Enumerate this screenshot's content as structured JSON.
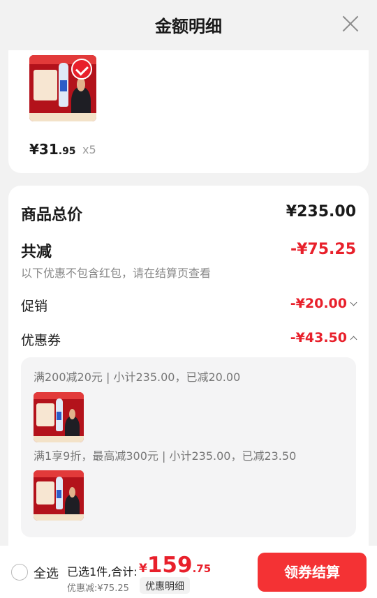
{
  "header": {
    "title": "金额明细",
    "close_icon": "close-icon"
  },
  "product": {
    "unit_price_main": "¥31",
    "unit_price_decimal": ".95",
    "quantity": "x5",
    "check_icon": "check-icon"
  },
  "summary": {
    "total_label": "商品总价",
    "total_value": "¥235.00",
    "reduce_label": "共减",
    "reduce_value": "-¥75.25",
    "reduce_note": "以下优惠不包含红包，请在结算页查看",
    "promo_label": "促销",
    "promo_value": "-¥20.00",
    "coupon_label": "优惠券",
    "coupon_value": "-¥43.50"
  },
  "coupon_details": [
    {
      "text": "满200减20元 | 小计235.00，已减20.00"
    },
    {
      "text": "满1享9折，最高减300元 | 小计235.00，已减23.50"
    }
  ],
  "bottom_bar": {
    "select_all": "全选",
    "selected_text": "已选1件,合计:",
    "currency": "¥",
    "total_int": "159",
    "total_dec": ".75",
    "discount_text": "优惠减:¥75.25",
    "detail_link": "优惠明细",
    "checkout_button": "领券结算"
  },
  "colors": {
    "accent": "#e8202b",
    "button": "#f43234",
    "background": "#f2f2f2"
  }
}
